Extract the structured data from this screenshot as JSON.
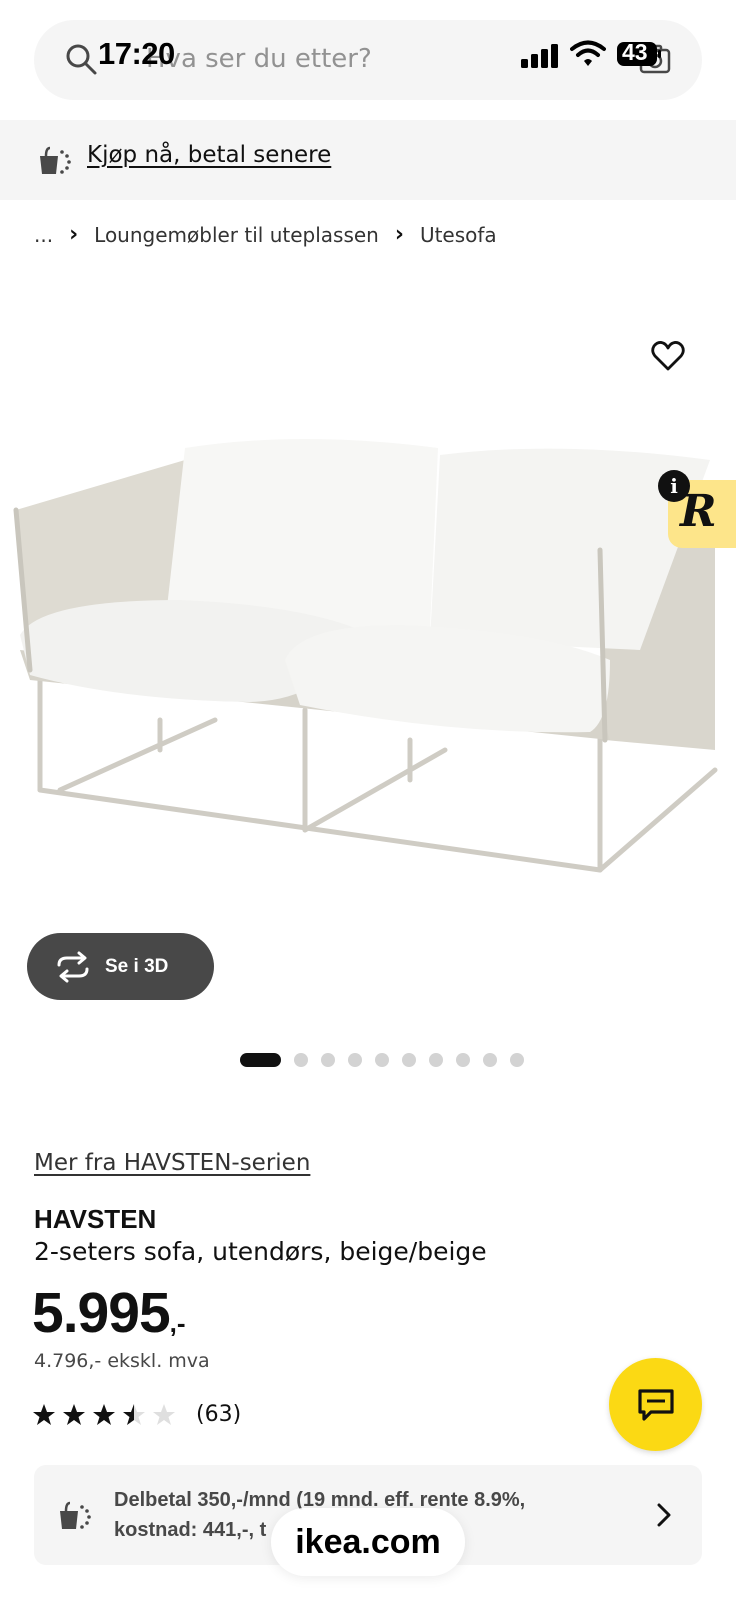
{
  "status_bar": {
    "time": "17:20",
    "battery": "43",
    "icons": [
      "signal-icon",
      "wifi-icon",
      "battery-icon"
    ]
  },
  "search": {
    "placeholder": "Hva ser du etter?",
    "icons": [
      "search-icon",
      "camera-icon"
    ]
  },
  "bnpl": {
    "label": "Kjøp nå, betal senere",
    "icon": "bnpl-bag-icon"
  },
  "breadcrumb": {
    "ellipsis": "...",
    "items": [
      "Loungemøbler til uteplassen",
      "Utesofa"
    ]
  },
  "gallery": {
    "view_3d_label": "Se i 3D",
    "total_images": 10,
    "active_index": 0,
    "badge_letter": "R",
    "info_glyph": "i"
  },
  "product": {
    "series_link": "Mer fra HAVSTEN-serien",
    "name": "HAVSTEN",
    "description": "2-seters sofa, utendørs, beige/beige",
    "price_main": "5.995",
    "price_suffix": ",-",
    "price_ex_vat": "4.796,- ekskl. mva",
    "rating": 3.5,
    "rating_max": 5,
    "review_count": "(63)"
  },
  "financing": {
    "line1": "Delbetal 350,-/mnd (19 mnd. eff. rente 8.9%,",
    "line2": "kostnad: 441,-, t"
  },
  "browser": {
    "url": "ikea.com"
  },
  "colors": {
    "accent_yellow": "#fbd914",
    "badge_yellow": "#fde58a",
    "dark_button": "#484848",
    "surface_gray": "#f5f5f5"
  }
}
